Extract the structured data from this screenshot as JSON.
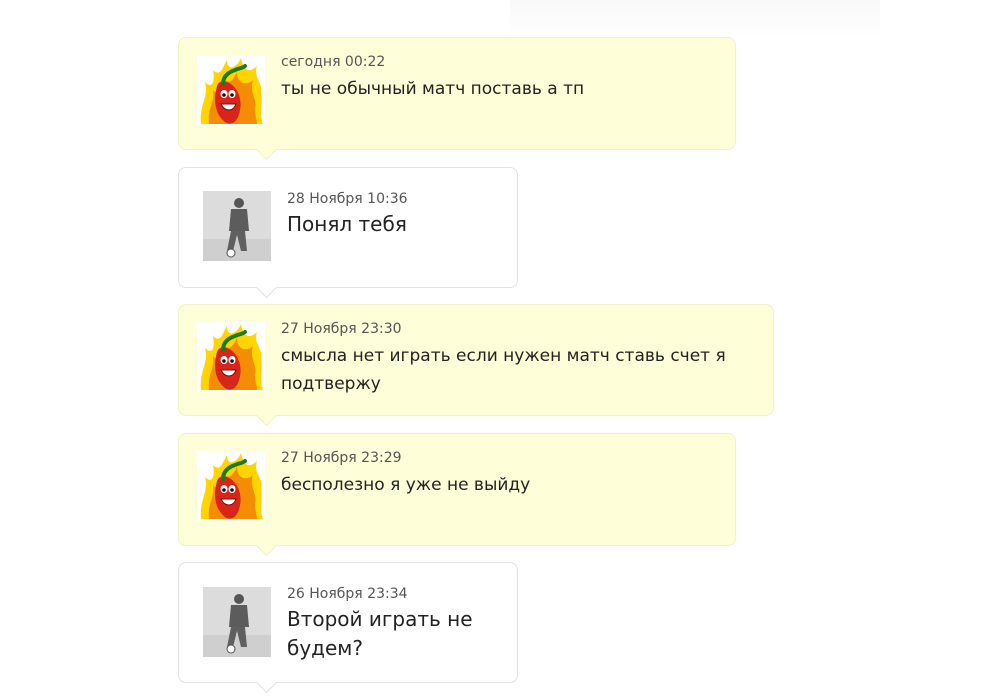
{
  "messages": [
    {
      "time": "сегодня 00:22",
      "text": "ты не обычный матч поставь а тп",
      "author_avatar": "pepper-avatar"
    },
    {
      "time": "28 Ноября 10:36",
      "text": "Понял тебя",
      "author_avatar": "player-avatar"
    },
    {
      "time": "27 Ноября 23:30",
      "text": "смысла нет играть если нужен матч ставь счет я подтвержу",
      "author_avatar": "pepper-avatar"
    },
    {
      "time": "27 Ноября 23:29",
      "text": "бесполезно я уже не выйду",
      "author_avatar": "pepper-avatar"
    },
    {
      "time": "26 Ноября 23:34",
      "text": "Второй играть не будем?",
      "author_avatar": "player-avatar"
    }
  ],
  "colors": {
    "mine_bubble": "#fefed8",
    "theirs_bubble": "#ffffff",
    "pepper_red": "#d8241b",
    "flame_yellow": "#ffd400",
    "flame_orange": "#f48c06"
  }
}
